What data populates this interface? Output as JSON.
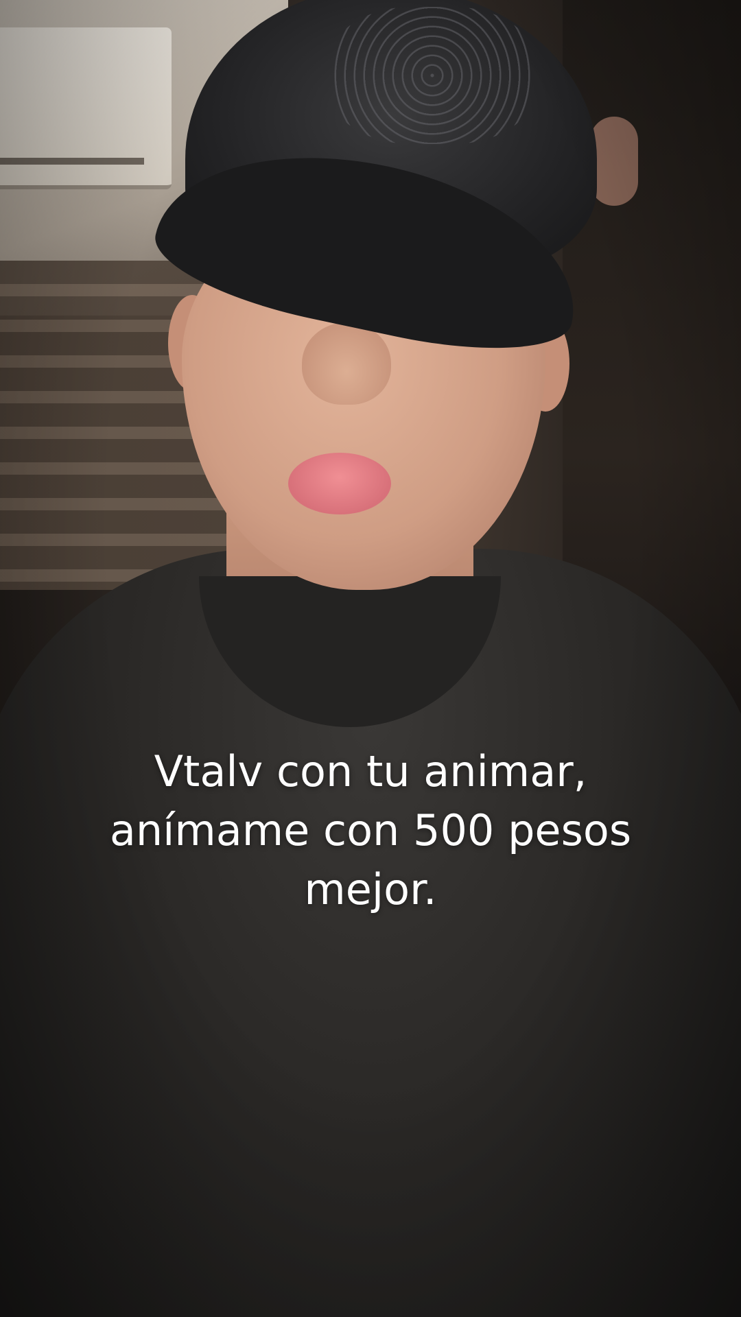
{
  "caption": {
    "lines": [
      "Vtalv con tu animar,",
      "anímame con 500 pesos",
      "mejor."
    ]
  }
}
